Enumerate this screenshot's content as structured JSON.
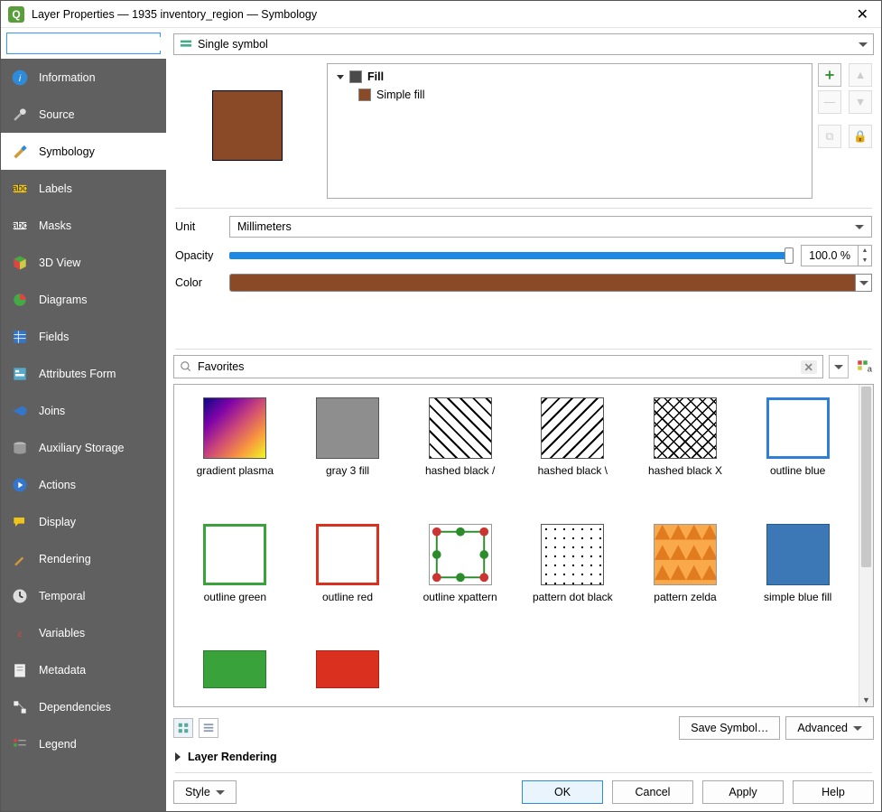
{
  "window": {
    "title": "Layer Properties — 1935 inventory_region — Symbology"
  },
  "sidebar": {
    "search_placeholder": "",
    "items": [
      {
        "label": "Information"
      },
      {
        "label": "Source"
      },
      {
        "label": "Symbology"
      },
      {
        "label": "Labels"
      },
      {
        "label": "Masks"
      },
      {
        "label": "3D View"
      },
      {
        "label": "Diagrams"
      },
      {
        "label": "Fields"
      },
      {
        "label": "Attributes Form"
      },
      {
        "label": "Joins"
      },
      {
        "label": "Auxiliary Storage"
      },
      {
        "label": "Actions"
      },
      {
        "label": "Display"
      },
      {
        "label": "Rendering"
      },
      {
        "label": "Temporal"
      },
      {
        "label": "Variables"
      },
      {
        "label": "Metadata"
      },
      {
        "label": "Dependencies"
      },
      {
        "label": "Legend"
      }
    ]
  },
  "renderer_combo": "Single symbol",
  "layer_tree": {
    "root": "Fill",
    "child": "Simple fill"
  },
  "unit_label": "Unit",
  "unit_value": "Millimeters",
  "opacity_label": "Opacity",
  "opacity_value": "100.0 %",
  "color_label": "Color",
  "preview_color": "#8a4a27",
  "favorites": {
    "search_value": "Favorites",
    "items": [
      {
        "label": "gradient plasma"
      },
      {
        "label": "gray 3 fill"
      },
      {
        "label": "hashed black /"
      },
      {
        "label": "hashed black \\"
      },
      {
        "label": "hashed black X"
      },
      {
        "label": "outline blue"
      },
      {
        "label": "outline green"
      },
      {
        "label": "outline red"
      },
      {
        "label": "outline xpattern"
      },
      {
        "label": "pattern dot black"
      },
      {
        "label": "pattern zelda"
      },
      {
        "label": "simple blue fill"
      }
    ]
  },
  "buttons": {
    "save_symbol": "Save Symbol…",
    "advanced": "Advanced",
    "style": "Style",
    "ok": "OK",
    "cancel": "Cancel",
    "apply": "Apply",
    "help": "Help"
  },
  "section_rendering": "Layer Rendering"
}
